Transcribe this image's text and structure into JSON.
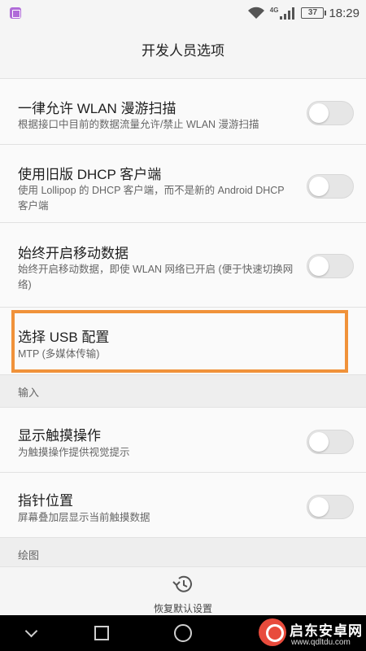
{
  "status_bar": {
    "network_type": "4G",
    "battery_level": "37",
    "time": "18:29",
    "icons": [
      "app-notification-icon",
      "wifi-icon",
      "signal-icon",
      "battery-icon"
    ]
  },
  "header": {
    "title": "开发人员选项"
  },
  "settings": [
    {
      "title": "一律允许 WLAN 漫游扫描",
      "subtitle": "根据接口中目前的数据流量允许/禁止 WLAN 漫游扫描",
      "toggle": "off"
    },
    {
      "title": "使用旧版 DHCP 客户端",
      "subtitle": "使用 Lollipop 的 DHCP 客户端，而不是新的 Android DHCP 客户端",
      "toggle": "off"
    },
    {
      "title": "始终开启移动数据",
      "subtitle": "始终开启移动数据，即使 WLAN 网络已开启 (便于快速切换网络)",
      "toggle": "off"
    },
    {
      "title": "选择 USB 配置",
      "subtitle": "MTP (多媒体传输)",
      "highlighted": true
    },
    {
      "section_header": "输入"
    },
    {
      "title": "显示触摸操作",
      "subtitle": "为触摸操作提供视觉提示",
      "toggle": "off"
    },
    {
      "title": "指针位置",
      "subtitle": "屏幕叠加层显示当前触摸数据",
      "toggle": "off"
    },
    {
      "section_header": "绘图"
    }
  ],
  "footer": {
    "restore_label": "恢复默认设置",
    "restore_icon": "history-icon"
  },
  "nav_bar": {
    "buttons": [
      "back-icon",
      "recent-apps-icon",
      "home-icon"
    ]
  },
  "watermark": {
    "title": "启东安卓网",
    "url": "www.qdltdu.com"
  },
  "colors": {
    "highlight": "#f0923a",
    "background": "#f5f5f5",
    "toggle_off": "#e6e6e6"
  }
}
